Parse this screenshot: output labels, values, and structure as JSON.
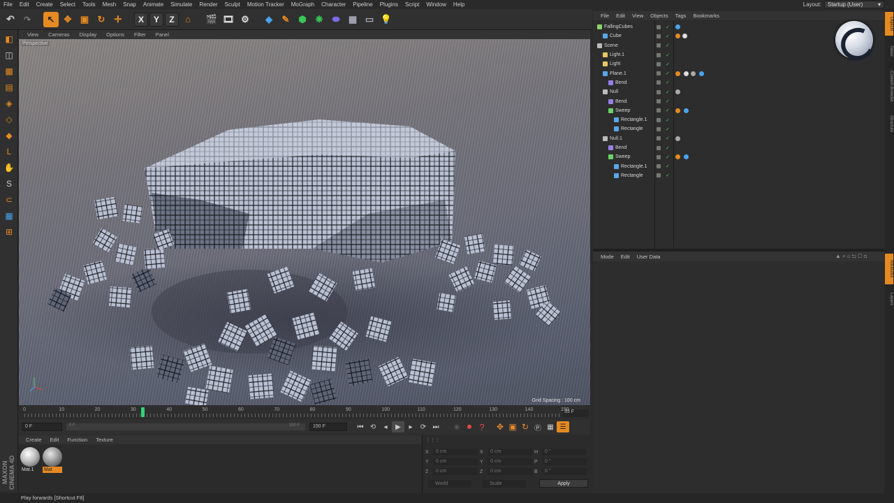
{
  "menubar": {
    "items": [
      "File",
      "Edit",
      "Create",
      "Select",
      "Tools",
      "Mesh",
      "Snap",
      "Animate",
      "Simulate",
      "Render",
      "Sculpt",
      "Motion Tracker",
      "MoGraph",
      "Character",
      "Pipeline",
      "Plugins",
      "Script",
      "Window",
      "Help"
    ],
    "layout_label": "Layout:",
    "layout_value": "Startup (User)"
  },
  "toolbar": {
    "axis_x": "X",
    "axis_y": "Y",
    "axis_z": "Z"
  },
  "viewport": {
    "menu": [
      "View",
      "Cameras",
      "Display",
      "Options",
      "Filter",
      "Panel"
    ],
    "label": "Perspective",
    "grid_spacing": "Grid Spacing : 100 cm"
  },
  "timeline": {
    "ticks": [
      "0",
      "10",
      "20",
      "30",
      "40",
      "50",
      "60",
      "70",
      "80",
      "90",
      "100",
      "110",
      "120",
      "130",
      "140",
      "150"
    ],
    "current_frame": 33,
    "max_frame": 150,
    "frame_display": "33 F"
  },
  "transport": {
    "start_field": "0 F",
    "min_field": "0 F",
    "max_range": "150 F",
    "end_field": "150 F"
  },
  "material_manager": {
    "menu": [
      "Create",
      "Edit",
      "Function",
      "Texture"
    ],
    "materials": [
      {
        "name": "Mat.1",
        "selected": false
      },
      {
        "name": "Mat",
        "selected": true
      }
    ]
  },
  "coordinates": {
    "rows": [
      {
        "a": "X",
        "av": "0 cm",
        "b": "X",
        "bv": "0 cm",
        "c": "H",
        "cv": "0 °"
      },
      {
        "a": "Y",
        "av": "0 cm",
        "b": "Y",
        "bv": "0 cm",
        "c": "P",
        "cv": "0 °"
      },
      {
        "a": "Z",
        "av": "0 cm",
        "b": "Z",
        "bv": "0 cm",
        "c": "B",
        "cv": "0 °"
      }
    ],
    "mode_world": "World",
    "mode_scale": "Scale",
    "apply": "Apply"
  },
  "object_manager": {
    "menu": [
      "File",
      "Edit",
      "View",
      "Objects",
      "Tags",
      "Bookmarks"
    ],
    "objects": [
      {
        "name": "FallingCubes",
        "depth": 0,
        "icon": "#8cd16a"
      },
      {
        "name": "Cube",
        "depth": 1,
        "icon": "#5aa7e8"
      },
      {
        "name": "Scene",
        "depth": 0,
        "icon": "#bbbbbb"
      },
      {
        "name": "Light.1",
        "depth": 1,
        "icon": "#e8c866"
      },
      {
        "name": "Light",
        "depth": 1,
        "icon": "#e8c866"
      },
      {
        "name": "Plane.1",
        "depth": 1,
        "icon": "#5aa7e8"
      },
      {
        "name": "Bend",
        "depth": 2,
        "icon": "#9a7ee6"
      },
      {
        "name": "Null",
        "depth": 1,
        "icon": "#bbbbbb"
      },
      {
        "name": "Bend",
        "depth": 2,
        "icon": "#9a7ee6"
      },
      {
        "name": "Sweep",
        "depth": 2,
        "icon": "#6bd16a"
      },
      {
        "name": "Rectangle.1",
        "depth": 3,
        "icon": "#5aa7e8"
      },
      {
        "name": "Rectangle",
        "depth": 3,
        "icon": "#5aa7e8"
      },
      {
        "name": "Null.1",
        "depth": 1,
        "icon": "#bbbbbb"
      },
      {
        "name": "Bend",
        "depth": 2,
        "icon": "#9a7ee6"
      },
      {
        "name": "Sweep",
        "depth": 2,
        "icon": "#6bd16a"
      },
      {
        "name": "Rectangle.1",
        "depth": 3,
        "icon": "#5aa7e8"
      },
      {
        "name": "Rectangle",
        "depth": 3,
        "icon": "#5aa7e8"
      }
    ]
  },
  "attribute_manager": {
    "menu": [
      "Mode",
      "Edit",
      "User Data"
    ]
  },
  "status": {
    "text": "Play forwards [Shortcut F8]"
  },
  "branding": {
    "logo_text": "MAXON CINEMA 4D"
  },
  "colors": {
    "accent": "#e58a22",
    "playhead": "#33d17a",
    "record": "#e24848"
  }
}
